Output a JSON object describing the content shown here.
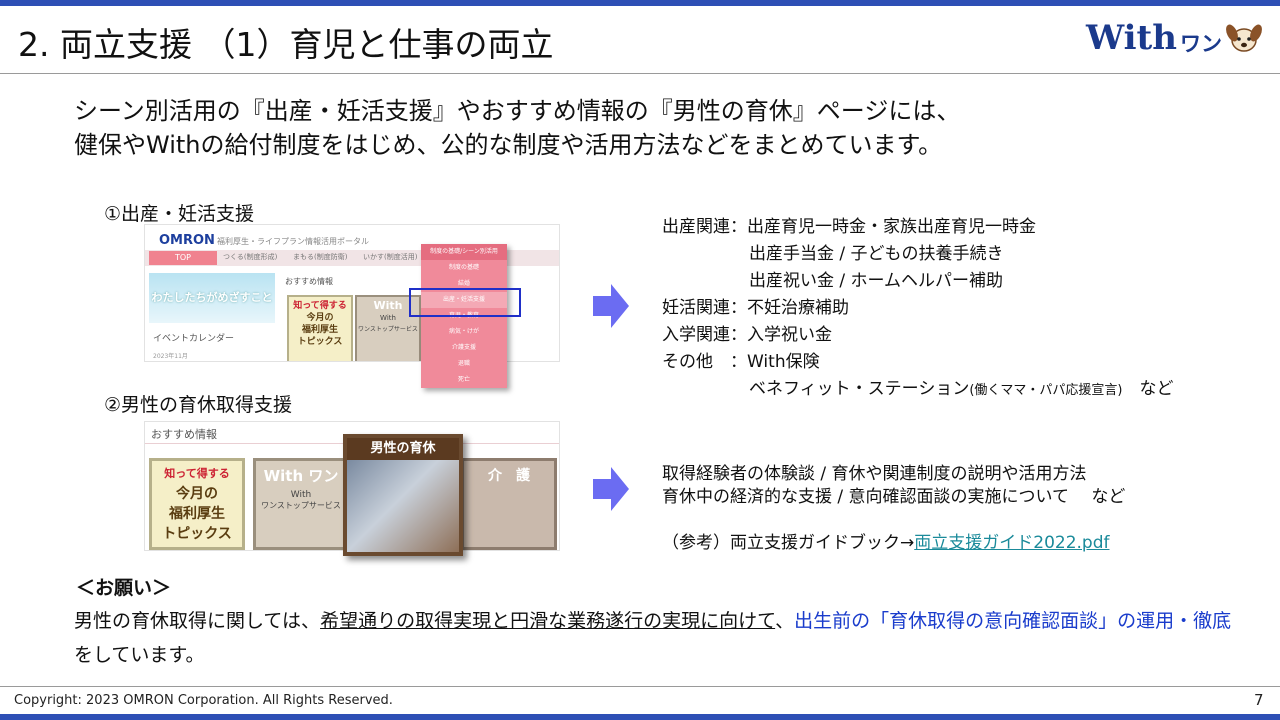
{
  "slide": {
    "title": "2. 両立支援 （1）育児と仕事の両立",
    "lead": [
      "シーン別活用の『出産・妊活支援』やおすすめ情報の『男性の育休』ページには、",
      "健保やWithの給付制度をはじめ、公的な制度や活用方法などをまとめています。"
    ],
    "logo": {
      "word": "With",
      "kana": "ワン"
    },
    "colors": {
      "accent_bar": "#2e4fb5",
      "arrow": "#6b6cf2",
      "highlight_box": "#1f2fc8",
      "pink_menu": "#f08a9a"
    }
  },
  "section1": {
    "label": "①出産・妊活支援",
    "screenshot": {
      "brand": "OMRON",
      "portal": "福利厚生・ライフプラン情報活用ポータル",
      "nav": [
        "TOP",
        "つくる(制度形成)",
        "まもる(制度防衛)",
        "いかす(制度活用)"
      ],
      "hero": "わたしたちがめざすこと",
      "recommend": "おすすめ情報",
      "event": "イベントカレンダー",
      "date": "2023年11月",
      "card1": [
        "知って得する",
        "今月の",
        "福利厚生",
        "トピックス"
      ],
      "card2": [
        "With",
        "With",
        "ワンストップサービス"
      ],
      "menu_header": "制度の基礎/シーン別活用",
      "menu": [
        "制度の基礎",
        "結婚",
        "出産・妊活支援",
        "育児・教育",
        "病気・けが",
        "介護支援",
        "退職",
        "死亡"
      ]
    },
    "info": [
      "出産関連：出産育児一時金・家族出産育児一時金",
      "出産手当金 / 子どもの扶養手続き",
      "出産祝い金 / ホームヘルパー補助",
      "妊活関連：不妊治療補助",
      "入学関連：入学祝い金",
      "その他　：With保険"
    ],
    "last_line": {
      "main": "ベネフィット・ステーション",
      "small": "(働くママ・パパ応援宣言)",
      "tail": "など"
    }
  },
  "section2": {
    "label": "②男性の育休取得支援",
    "screenshot": {
      "recommend": "おすすめ情報",
      "card1": [
        "知って得する",
        "今月の",
        "福利厚生",
        "トピックス"
      ],
      "card2": [
        "With ワン",
        "With",
        "ワンストップサービス"
      ],
      "card3": "男性の育休",
      "card4": "介　護"
    },
    "info": [
      "取得経験者の体験談 / 育休や関連制度の説明や活用方法",
      "育休中の経済的な支援 / 意向確認面談の実施について　 など"
    ],
    "ref_prefix": "（参考）両立支援ガイドブック→",
    "ref_link": "両立支援ガイド2022.pdf"
  },
  "request": {
    "heading": "＜お願い＞",
    "part1": "男性の育休取得に関しては、",
    "part2": "希望通りの取得実現と円滑な業務遂行の実現に向けて",
    "part3": "、",
    "part4": "出生前の「育休取得の意向確認面談」の運用・徹底",
    "part5": "をしています。"
  },
  "footer": {
    "copyright": "Copyright: 2023 OMRON Corporation. All Rights Reserved.",
    "page": "7"
  }
}
